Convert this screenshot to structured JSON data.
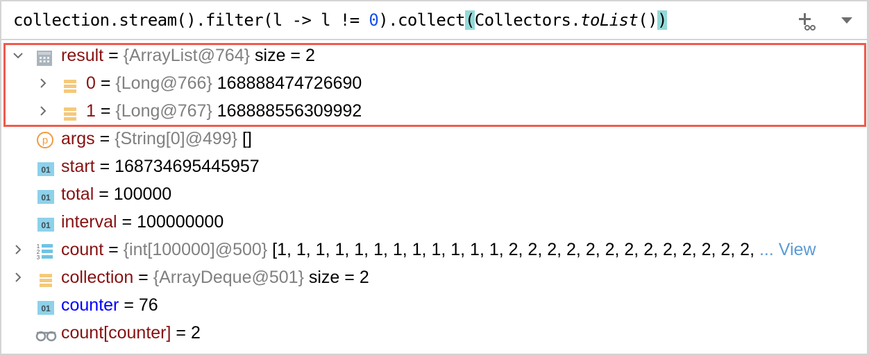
{
  "expression": {
    "parts": {
      "p1": "collection.stream().filter(l -> l != ",
      "p2": "0",
      "p3": ").collect",
      "p4": "(",
      "p5": "Collectors.",
      "p6": "toList",
      "p7": "()",
      "p8": ")"
    },
    "add_watch_icon": "add-watch-icon",
    "dropdown_icon": "dropdown-triangle-icon"
  },
  "variables": [
    {
      "name": "result",
      "type": "{ArrayList@764}",
      "value": " size = 2",
      "icon": "table-icon",
      "expandable": true,
      "expanded": true,
      "highlighted": true
    },
    {
      "name": "0",
      "type": "{Long@766}",
      "value": "168888474726690",
      "icon": "list-item-icon",
      "expandable": true,
      "child": true
    },
    {
      "name": "1",
      "type": "{Long@767}",
      "value": "168888556309992",
      "icon": "list-item-icon",
      "expandable": true,
      "child": true
    },
    {
      "name": "args",
      "type": "{String[0]@499}",
      "value": "[]",
      "icon": "parameter-icon"
    },
    {
      "name": "start",
      "type": "",
      "value": "168734695445957",
      "icon": "primitive-icon",
      "icon_label": "01"
    },
    {
      "name": "total",
      "type": "",
      "value": "100000",
      "icon": "primitive-icon",
      "icon_label": "01"
    },
    {
      "name": "interval",
      "type": "",
      "value": "100000000",
      "icon": "primitive-icon",
      "icon_label": "01"
    },
    {
      "name": "count",
      "type": "{int[100000]@500}",
      "value": "[1, 1, 1, 1, 1, 1, 1, 1, 1, 1, 1, 1, 2, 2, 2, 2, 2, 2, 2, 2, 2, 2, 2, 2, 2, ",
      "link": "... View",
      "icon": "array-icon",
      "expandable": true
    },
    {
      "name": "collection",
      "type": "{ArrayDeque@501}",
      "value": " size = 2",
      "icon": "list-item-icon",
      "expandable": true
    },
    {
      "name": "counter",
      "type": "",
      "value": "76",
      "icon": "primitive-icon",
      "icon_label": "01",
      "name_color": "blue"
    },
    {
      "name": "count[counter]",
      "type": "",
      "value": "2",
      "icon": "watch-glasses-icon"
    }
  ],
  "colors": {
    "highlight_border": "#f05a4d",
    "variable_name": "#871111",
    "modified_name": "#0000ff",
    "type_text": "#808080",
    "view_link": "#5b9bd5"
  }
}
